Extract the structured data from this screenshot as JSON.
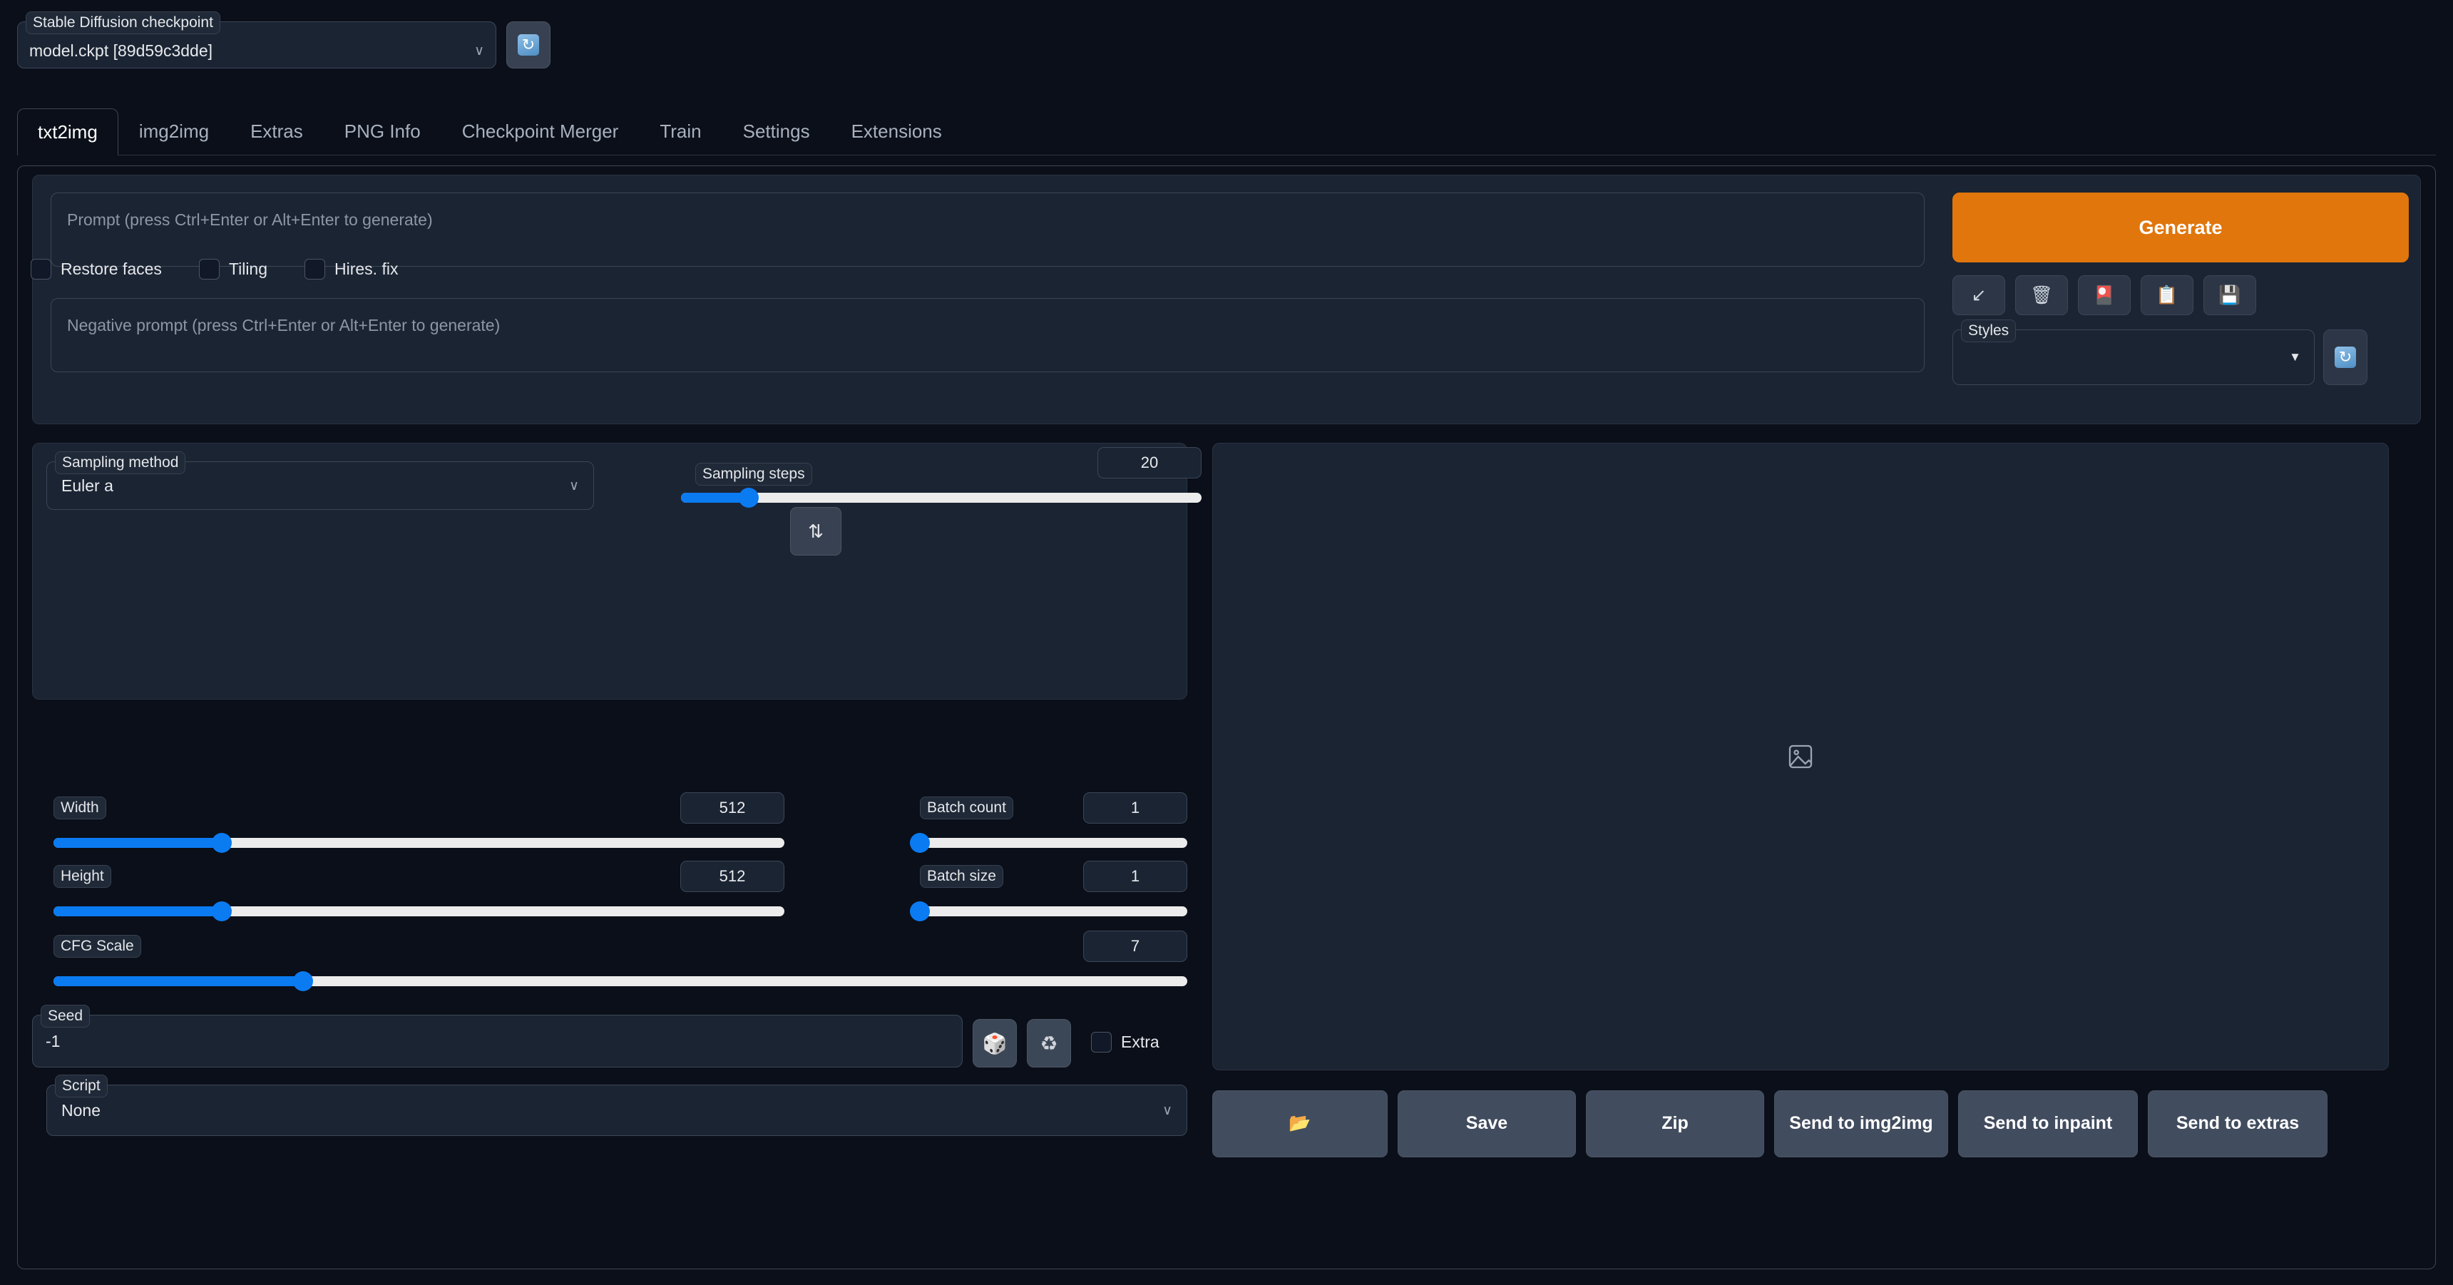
{
  "checkpoint": {
    "label": "Stable Diffusion checkpoint",
    "value": "model.ckpt [89d59c3dde]",
    "chevron": "∨",
    "refresh_icon": "↻"
  },
  "tabs": [
    {
      "label": "txt2img",
      "active": true
    },
    {
      "label": "img2img",
      "active": false
    },
    {
      "label": "Extras",
      "active": false
    },
    {
      "label": "PNG Info",
      "active": false
    },
    {
      "label": "Checkpoint Merger",
      "active": false
    },
    {
      "label": "Train",
      "active": false
    },
    {
      "label": "Settings",
      "active": false
    },
    {
      "label": "Extensions",
      "active": false
    }
  ],
  "prompt": {
    "placeholder": "Prompt (press Ctrl+Enter or Alt+Enter to generate)",
    "value": ""
  },
  "negative_prompt": {
    "placeholder": "Negative prompt (press Ctrl+Enter or Alt+Enter to generate)",
    "value": ""
  },
  "generate": {
    "label": "Generate",
    "color": "#e0760c"
  },
  "prompt_tools": [
    {
      "name": "read-generation-parameters-icon",
      "glyph": "↙"
    },
    {
      "name": "clear-prompt-icon",
      "glyph": "🗑"
    },
    {
      "name": "apply-style-icon",
      "glyph": "🎴"
    },
    {
      "name": "paste-style-icon",
      "glyph": "📋"
    },
    {
      "name": "save-style-icon",
      "glyph": "💾"
    }
  ],
  "styles": {
    "label": "Styles",
    "value": "",
    "caret": "▼",
    "refresh_icon": "↻"
  },
  "sampling_method": {
    "label": "Sampling method",
    "value": "Euler a",
    "chevron": "∨"
  },
  "sampling_steps": {
    "label": "Sampling steps",
    "value": "20",
    "min": 1,
    "max": 150,
    "percent": 13
  },
  "checkboxes": [
    {
      "label": "Restore faces",
      "checked": false
    },
    {
      "label": "Tiling",
      "checked": false
    },
    {
      "label": "Hires. fix",
      "checked": false
    }
  ],
  "width": {
    "label": "Width",
    "value": "512",
    "min": 64,
    "max": 2048,
    "percent": 23
  },
  "height": {
    "label": "Height",
    "value": "512",
    "min": 64,
    "max": 2048,
    "percent": 23
  },
  "swap_button": {
    "name": "swap-dimensions",
    "glyph": "⇅"
  },
  "batch_count": {
    "label": "Batch count",
    "value": "1",
    "min": 1,
    "max": 100,
    "percent": 0
  },
  "batch_size": {
    "label": "Batch size",
    "value": "1",
    "min": 1,
    "max": 8,
    "percent": 0
  },
  "cfg_scale": {
    "label": "CFG Scale",
    "value": "7",
    "min": 1,
    "max": 30,
    "percent": 22
  },
  "seed": {
    "label": "Seed",
    "value": "-1",
    "random_icon": "🎲",
    "reuse_icon": "♻",
    "extra_label": "Extra",
    "extra_checked": false
  },
  "script": {
    "label": "Script",
    "value": "None",
    "chevron": "∨"
  },
  "output": {
    "placeholder_icon": "image-placeholder",
    "buttons": [
      {
        "name": "open-folder-button",
        "label": "📂",
        "is_icon": true
      },
      {
        "name": "save-button",
        "label": "Save",
        "is_icon": false
      },
      {
        "name": "zip-button",
        "label": "Zip",
        "is_icon": false
      },
      {
        "name": "send-to-img2img-button",
        "label": "Send to img2img",
        "is_icon": false
      },
      {
        "name": "send-to-inpaint-button",
        "label": "Send to inpaint",
        "is_icon": false
      },
      {
        "name": "send-to-extras-button",
        "label": "Send to extras",
        "is_icon": false
      }
    ]
  }
}
